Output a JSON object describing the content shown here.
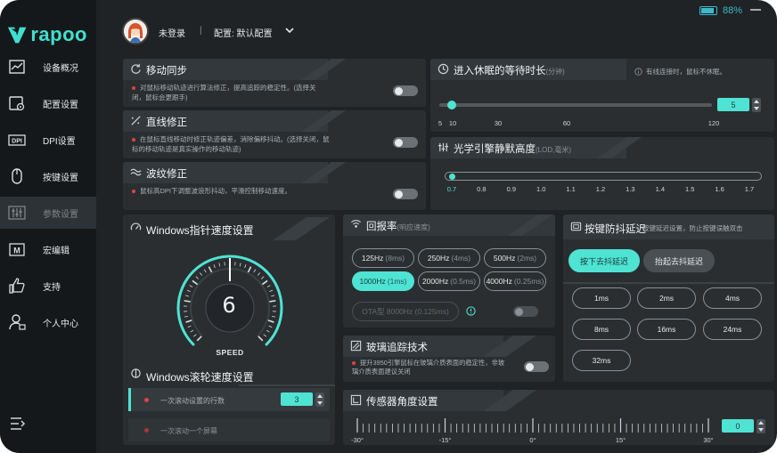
{
  "brand": {
    "logo_text": "rapoo"
  },
  "sidebar": {
    "items": [
      {
        "label": "设备概况",
        "icon": "chart-icon"
      },
      {
        "label": "配置设置",
        "icon": "config-icon"
      },
      {
        "label": "DPI设置",
        "icon": "dpi-icon"
      },
      {
        "label": "按键设置",
        "icon": "mouse-icon"
      },
      {
        "label": "参数设置",
        "icon": "sliders-icon"
      },
      {
        "label": "宏编辑",
        "icon": "macro-icon"
      },
      {
        "label": "支持",
        "icon": "thumbs-up-icon"
      },
      {
        "label": "个人中心",
        "icon": "user-icon"
      }
    ],
    "active_index": 4
  },
  "header": {
    "user_status": "未登录",
    "separator": "|",
    "profile_label": "配置: 默认配置",
    "battery_percent": "88%",
    "battery_level": 0.88
  },
  "motion_sync": {
    "title": "移动同步",
    "desc": "对鼠标移动轨迹进行算法修正，提高追踪的稳定性。(选择关闭，鼠标会更跟手)",
    "enabled": false
  },
  "angle_snap": {
    "title": "直线修正",
    "desc": "在鼠标直线移动时修正轨迹偏差，消除偏移抖动。(选择关闭，鼠标的移动轨迹是真实操作的移动轨迹)",
    "enabled": false
  },
  "ripple": {
    "title": "波纹修正",
    "desc": "鼠标高DPI下调整波浪形抖动，平滑控制移动速度。",
    "enabled": false
  },
  "sleep": {
    "title": "进入休眠的等待时长",
    "unit": "(分钟)",
    "note": "有线连接时，鼠标不休眠。",
    "value": "5",
    "min": 0,
    "max": 120,
    "ticks": [
      "5",
      "10",
      "30",
      "60",
      "120"
    ]
  },
  "lod": {
    "title": "光学引擎静默高度",
    "unit": "(LOD,毫米)",
    "ticks": [
      "0.7",
      "0.8",
      "0.9",
      "1.0",
      "1.1",
      "1.2",
      "1.3",
      "1.4",
      "1.5",
      "1.6",
      "1.7"
    ],
    "selected_index": 0
  },
  "pointer_speed": {
    "title": "Windows指针速度设置",
    "value": "6",
    "label": "SPEED",
    "level": 0.5
  },
  "scroll_speed": {
    "title": "Windows滚轮速度设置",
    "rows": [
      {
        "label": "一次滚动设置的行数",
        "value": "3"
      },
      {
        "label": "一次滚动一个屏幕"
      }
    ]
  },
  "polling": {
    "title": "回报率",
    "unit": "(响应速度)",
    "options": [
      {
        "hz": "125Hz",
        "ms": "(8ms)"
      },
      {
        "hz": "250Hz",
        "ms": "(4ms)"
      },
      {
        "hz": "500Hz",
        "ms": "(2ms)"
      },
      {
        "hz": "1000Hz",
        "ms": "(1ms)"
      },
      {
        "hz": "2000Hz",
        "ms": "(0.5ms)"
      },
      {
        "hz": "4000Hz",
        "ms": "(0.25ms)"
      }
    ],
    "active_index": 3,
    "ota_label": "OTA型 8000Hz (0.125ms)",
    "ota_enabled": false
  },
  "debounce": {
    "title": "按键防抖延迟",
    "subtitle": "按键延迟设置，防止按键误触双击",
    "tab_press": "按下去抖延迟",
    "tab_release": "抬起去抖延迟",
    "options": [
      "1ms",
      "2ms",
      "4ms",
      "8ms",
      "16ms",
      "24ms",
      "32ms"
    ]
  },
  "glass": {
    "title": "玻璃追踪技术",
    "desc": "提升3950引擎鼠标在玻璃介质表面的稳定性，非玻璃介质表面建议关闭",
    "enabled": false
  },
  "sensor_angle": {
    "title": "传感器角度设置",
    "value": "0",
    "ticks": [
      "-30°",
      "-15°",
      "0°",
      "15°",
      "30°"
    ],
    "min": -30,
    "max": 30
  },
  "colors": {
    "accent": "#4fe3d3",
    "bg": "#1f2326",
    "card": "#2a2e31"
  }
}
